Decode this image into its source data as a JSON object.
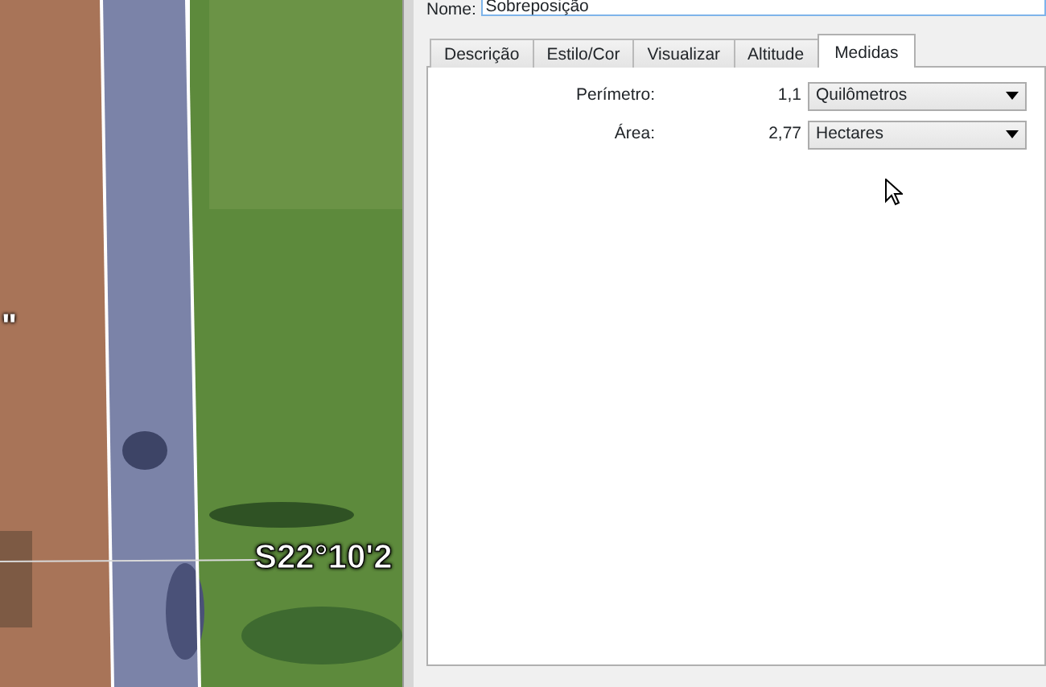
{
  "map": {
    "edge_label": "\"",
    "coordinate_label": "S22°10'2"
  },
  "name_field": {
    "label": "Nome:",
    "value": "Sobreposição"
  },
  "tabs": [
    {
      "label": "Descrição",
      "selected": false
    },
    {
      "label": "Estilo/Cor",
      "selected": false
    },
    {
      "label": "Visualizar",
      "selected": false
    },
    {
      "label": "Altitude",
      "selected": false
    },
    {
      "label": "Medidas",
      "selected": true
    }
  ],
  "measures": [
    {
      "label": "Perímetro:",
      "value": "1,1",
      "unit": "Quilômetros"
    },
    {
      "label": "Área:",
      "value": "2,77",
      "unit": "Hectares"
    }
  ]
}
